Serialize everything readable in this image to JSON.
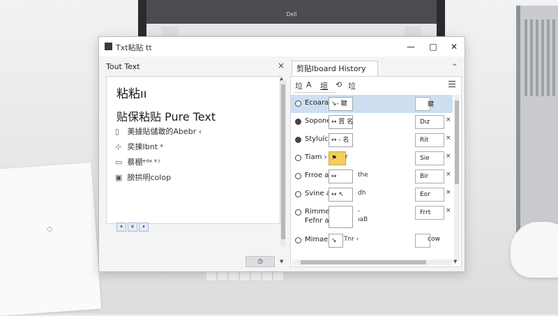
{
  "window": {
    "title": "Txt粘贴 tt   ",
    "minimize": "—",
    "maximize": "□",
    "close": "✕"
  },
  "left": {
    "header": "Tout Text",
    "header_close": "×",
    "line1": "粘粘ıı",
    "line2": "贴保粘贴 Pure Text",
    "options": [
      {
        "icon": "▯",
        "label": "美據貼儲敢的Abebr ‹"
      },
      {
        "icon": "⊹",
        "label": "奕揀Ibnt ᵃ"
      },
      {
        "icon": "▭",
        "label": "蔡棚ᵉᵈᵃ ᵏᵓ"
      },
      {
        "icon": "▣",
        "label": "膀拱明colop"
      }
    ],
    "mini_tools": [
      "✦",
      "¥",
      "▾"
    ],
    "footer_button": "◷"
  },
  "right": {
    "tab": "剪贴lboard History",
    "caret": "^",
    "toolbar": {
      "t1": "垃",
      "t2": "A",
      "t3": "垣",
      "t4": "⟲",
      "t5": "垃"
    },
    "rows": [
      {
        "name": "Ecoara",
        "key": "↘- 鍵",
        "extra": "",
        "extra2": "",
        "val": "",
        "val_extra": "鍵",
        "del": "",
        "selected": true,
        "radio": "off"
      },
      {
        "name": "Sopone",
        "key": "↔ 質 名",
        "extra": "",
        "extra2": "",
        "val": "Dız",
        "val_extra": "",
        "del": "×",
        "selected": false,
        "radio": "on"
      },
      {
        "name": "Styluícl",
        "key": "↔ - 名",
        "extra": "",
        "extra2": "",
        "val": "Rit",
        "val_extra": "",
        "del": "×",
        "selected": false,
        "radio": "on"
      },
      {
        "name": "Tiam ›",
        "key": "⚑",
        "extra": "r",
        "extra2": "",
        "val": "Sie",
        "val_extra": "",
        "del": "×",
        "selected": false,
        "radio": "off"
      },
      {
        "name": "Frroe a",
        "key": "↔",
        "extra": "the",
        "extra2": "",
        "val": "Bir",
        "val_extra": "",
        "del": "×",
        "selected": false,
        "radio": "off"
      },
      {
        "name": "Svine al",
        "key": "↔ ↖",
        "extra": "dh",
        "extra2": "",
        "val": "Eor",
        "val_extra": "",
        "del": "×",
        "selected": false,
        "radio": "off"
      },
      {
        "name": "Rimmer",
        "key": "",
        "extra": "-",
        "extra2": "ıaB",
        "val": "Frrt",
        "val_extra": "",
        "del": "×",
        "selected": false,
        "radio": "off"
      },
      {
        "name": "Mimae",
        "key": "↘",
        "extra": "Tnr ‹",
        "extra2": "",
        "val": "",
        "val_extra": "cow",
        "del": "",
        "selected": false,
        "radio": "off"
      }
    ],
    "row7_line2": "Fefnr a"
  },
  "scene": {
    "monitor_logo": "Dell"
  }
}
